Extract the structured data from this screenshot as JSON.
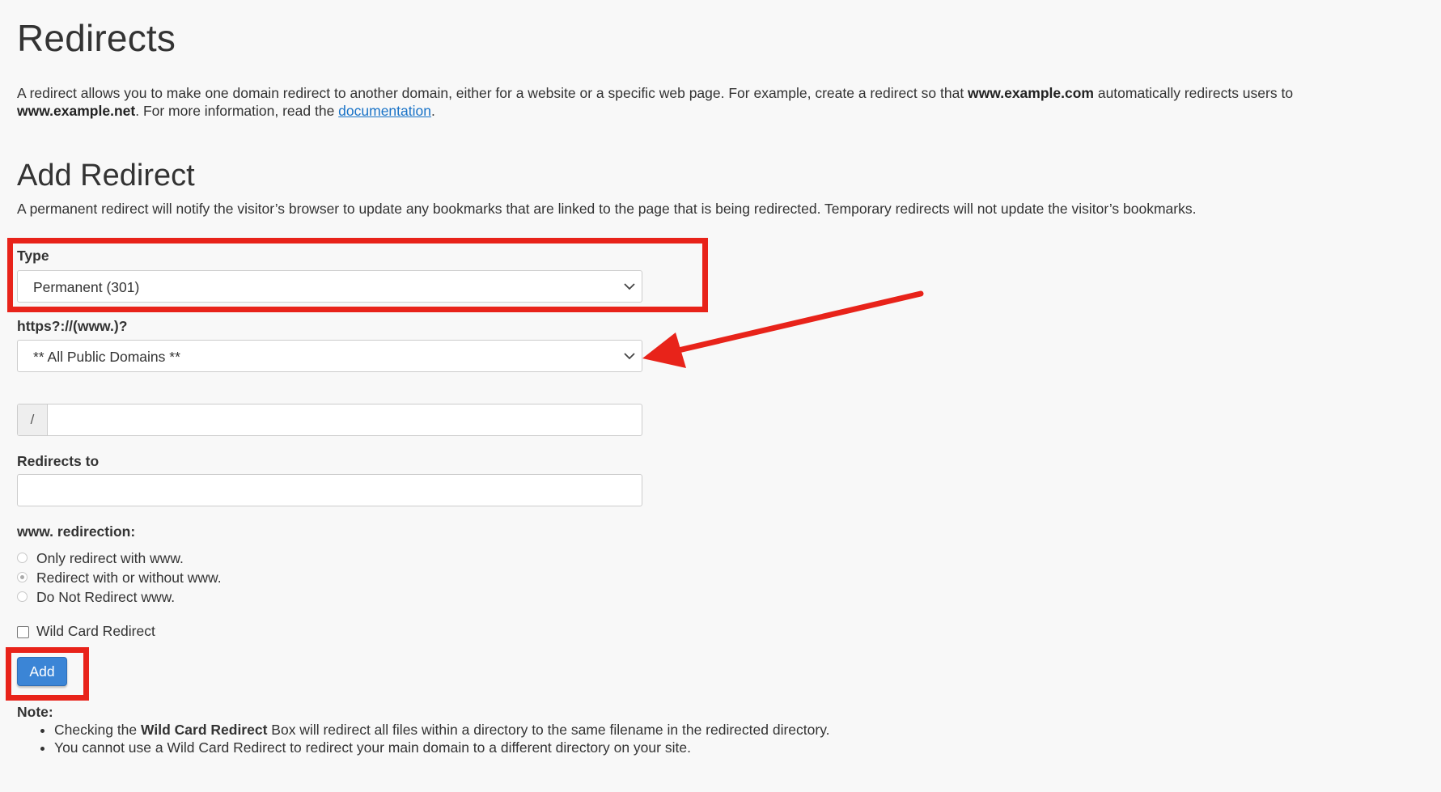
{
  "page": {
    "title": "Redirects",
    "intro": {
      "part1": "A redirect allows you to make one domain redirect to another domain, either for a website or a specific web page. For example, create a redirect so that ",
      "bold1": "www.example.com",
      "part2": " automatically redirects users to ",
      "bold2": "www.example.net",
      "part3": ". For more information, read the ",
      "link": "documentation",
      "part4": "."
    }
  },
  "form": {
    "heading": "Add Redirect",
    "description": "A permanent redirect will notify the visitor’s browser to update any bookmarks that are linked to the page that is being redirected. Temporary redirects will not update the visitor’s bookmarks.",
    "type_label": "Type",
    "type_value": "Permanent (301)",
    "domain_label": "https?://(www.)?",
    "domain_value": "** All Public Domains **",
    "path_prefix": "/",
    "path_value": "",
    "redirects_to_label": "Redirects to",
    "redirects_to_value": "",
    "www_label": "www. redirection:",
    "www_options": [
      {
        "label": "Only redirect with www.",
        "checked": false
      },
      {
        "label": "Redirect with or without www.",
        "checked": true
      },
      {
        "label": "Do Not Redirect www.",
        "checked": false
      }
    ],
    "wildcard_label": "Wild Card Redirect",
    "wildcard_checked": false,
    "add_button": "Add"
  },
  "note": {
    "title": "Note:",
    "item1_pre": "Checking the ",
    "item1_bold": "Wild Card Redirect",
    "item1_post": " Box will redirect all files within a directory to the same filename in the redirected directory.",
    "item2": "You cannot use a Wild Card Redirect to redirect your main domain to a different directory on your site."
  },
  "colors": {
    "accent": "#3b85d6",
    "annotation": "#e8231a",
    "link": "#1a73c7"
  }
}
